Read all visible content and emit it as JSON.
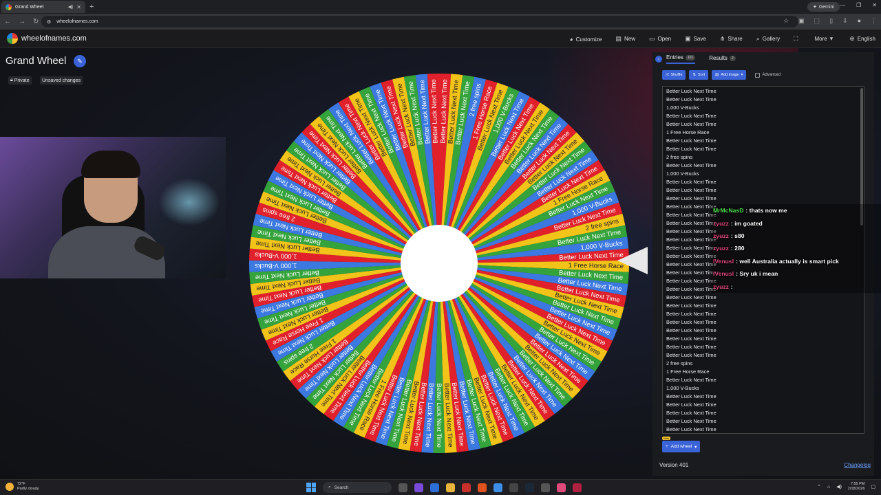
{
  "browser": {
    "tab_title": "Grand Wheel",
    "url": "wheelofnames.com",
    "gemini_label": "Gemini"
  },
  "site": {
    "name": "wheelofnames.com",
    "menu": [
      {
        "label": "Customize",
        "icon": "palette-icon",
        "glyph": "◕"
      },
      {
        "label": "New",
        "icon": "new-file-icon",
        "glyph": "▤"
      },
      {
        "label": "Open",
        "icon": "folder-icon",
        "glyph": "▭"
      },
      {
        "label": "Save",
        "icon": "save-icon",
        "glyph": "▣"
      },
      {
        "label": "Share",
        "icon": "share-icon",
        "glyph": "⋔"
      },
      {
        "label": "Gallery",
        "icon": "search-icon",
        "glyph": "⌕"
      },
      {
        "label": "",
        "icon": "fullscreen-icon",
        "glyph": "⛶"
      },
      {
        "label": "More",
        "icon": "chevron-down-icon",
        "glyph": "▾"
      },
      {
        "label": "English",
        "icon": "globe-icon",
        "glyph": "⊕"
      }
    ]
  },
  "wheel": {
    "title": "Grand Wheel",
    "privacy_label": "Private",
    "unsaved_label": "Unsaved changes",
    "colors": [
      "#e0212b",
      "#f2c318",
      "#35a33c",
      "#3b78e0"
    ],
    "segments": [
      "Better Luck Next Time",
      "Better Luck Next Time",
      "Better Luck Next Time",
      "2 free spins",
      "1 Free Horse Race",
      "Better Luck Next Time",
      "1,000 V-Bucks",
      "Better Luck Next Time",
      "Better Luck Next Time",
      "Better Luck Next Time",
      "Better Luck Next Time",
      "Better Luck Next Time",
      "Better Luck Next Time",
      "Better Luck Next Time",
      "Better Luck Next Time",
      "Better Luck Next Time",
      "Better Luck Next Time",
      "1 Free Horse Race",
      "Better Luck Next Time",
      "1,000 V-Bucks",
      "Better Luck Next Time",
      "2 free spins",
      "Better Luck Next Time",
      "1,000 V-Bucks",
      "Better Luck Next Time",
      "1 Free Horse Race",
      "Better Luck Next Time",
      "Better Luck Next Time",
      "Better Luck Next Time",
      "Better Luck Next Time",
      "Better Luck Next Time",
      "Better Luck Next Time",
      "Better Luck Next Time",
      "Better Luck Next Time",
      "Better Luck Next Time",
      "Better Luck Next Time",
      "Better Luck Next Time",
      "Better Luck Next Time",
      "Better Luck Next Time",
      "Better Luck Next Time",
      "Better Luck Next Time",
      "Better Luck Next Time",
      "Better Luck Next Time",
      "Better Luck Next Time",
      "Better Luck Next Time",
      "Better Luck Next Time",
      "Better Luck Next Time",
      "Better Luck Next Time",
      "Better Luck Next Time",
      "Better Luck Next Time",
      "Better Luck Next Time",
      "Better Luck Next Time",
      "Better Luck Next Time",
      "Better Luck Next Time",
      "Better Luck Next Time",
      "Better Luck Next Time",
      "Better Luck Next Time",
      "1 Free Horse Race",
      "Better Luck Next Time",
      "Better Luck Next Time",
      "Better Luck Next Time",
      "Better Luck Next Time",
      "Better Luck Next Time",
      "Better Luck Next Time",
      "Better Luck Next Time",
      "1 Free Horse Race",
      "2 free spins",
      "Better Luck Next Time",
      "1 Free Horse Race",
      "Better Luck Next Time",
      "Better Luck Next Time",
      "Better Luck Next Time",
      "Better Luck Next Time",
      "Better Luck Next Time",
      "Better Luck Next Time",
      "1,000 V-Bucks",
      "1,000 V-Bucks",
      "Better Luck Next Time",
      "Better Luck Next Time",
      "Better Luck Next Time",
      "2 free spins",
      "Better Luck Next Time",
      "Better Luck Next Time",
      "Better Luck Next Time",
      "Better Luck Next Time",
      "Better Luck Next Time",
      "Better Luck Next Time",
      "Better Luck Next Time",
      "Better Luck Next Time",
      "Better Luck Next Time",
      "Better Luck Next Time",
      "Better Luck Next Time",
      "Better Luck Next Time",
      "Better Luck Next Time",
      "Better Luck Next Time",
      "Better Luck Next Time",
      "Better Luck Next Time",
      "Better Luck Next Time",
      "Better Luck Next Time",
      "Better Luck Next Time",
      "Better Luck Next Time"
    ]
  },
  "panel": {
    "tab_entries": "Entries",
    "entries_count": "101",
    "tab_results": "Results",
    "results_count": "2",
    "shuffle": "Shuffle",
    "sort": "Sort",
    "add_image": "Add image",
    "advanced": "Advanced",
    "add_wheel": "Add wheel",
    "new_tag": "New",
    "version": "Version 401",
    "changelog": "Changelog",
    "entries": [
      "Better Luck Next Time",
      "Better Luck Next Time",
      "1,000 V-Bucks",
      "Better Luck Next Time",
      "Better Luck Next Time",
      "1 Free Horse Race",
      "Better Luck Next Time",
      "Better Luck Next Time",
      "2 free spins",
      "Better Luck Next Time",
      "1,000 V-Bucks",
      "Better Luck Next Time",
      "Better Luck Next Time",
      "Better Luck Next Time",
      "Better Luck Next Time",
      "Better Luck Next Time",
      "Better Luck Next Time",
      "Better Luck Next Time",
      "Better Luck Next Time",
      "Better Luck Next Time",
      "Better Luck Next Time",
      "Better Luck Next Time",
      "Better Luck Next Time",
      "Better Luck Next Time",
      "Better Luck Next Time",
      "Better Luck Next Time",
      "Better Luck Next Time",
      "Better Luck Next Time",
      "Better Luck Next Time",
      "Better Luck Next Time",
      "Better Luck Next Time",
      "Better Luck Next Time",
      "Better Luck Next Time",
      "2 free spins",
      "1 Free Horse Race",
      "Better Luck Next Time",
      "1,000 V-Bucks",
      "Better Luck Next Time",
      "Better Luck Next Time",
      "Better Luck Next Time",
      "Better Luck Next Time",
      "Better Luck Next Time"
    ]
  },
  "chat": [
    {
      "user": "MrMcNasD",
      "color": "#4fe04f",
      "text": ": thats now me"
    },
    {
      "user": "zyuzz",
      "color": "#e04a7a",
      "text": ": im goated"
    },
    {
      "user": "zyuzz",
      "color": "#e04a7a",
      "text": ": s80"
    },
    {
      "user": "zyuzz",
      "color": "#e04a7a",
      "text": ": 280"
    },
    {
      "user": "lVenusl",
      "color": "#e04a7a",
      "text": ": well Australia actually is smart pick"
    },
    {
      "user": "lVenusl",
      "color": "#e04a7a",
      "text": ": Sry uk i mean"
    },
    {
      "user": "zyuzz",
      "color": "#e04a7a",
      "text": ": "
    }
  ],
  "taskbar": {
    "temp": "72°F",
    "weather": "Partly cloudy",
    "search": "Search",
    "time": "7:55 PM",
    "date": "2/18/2026"
  }
}
